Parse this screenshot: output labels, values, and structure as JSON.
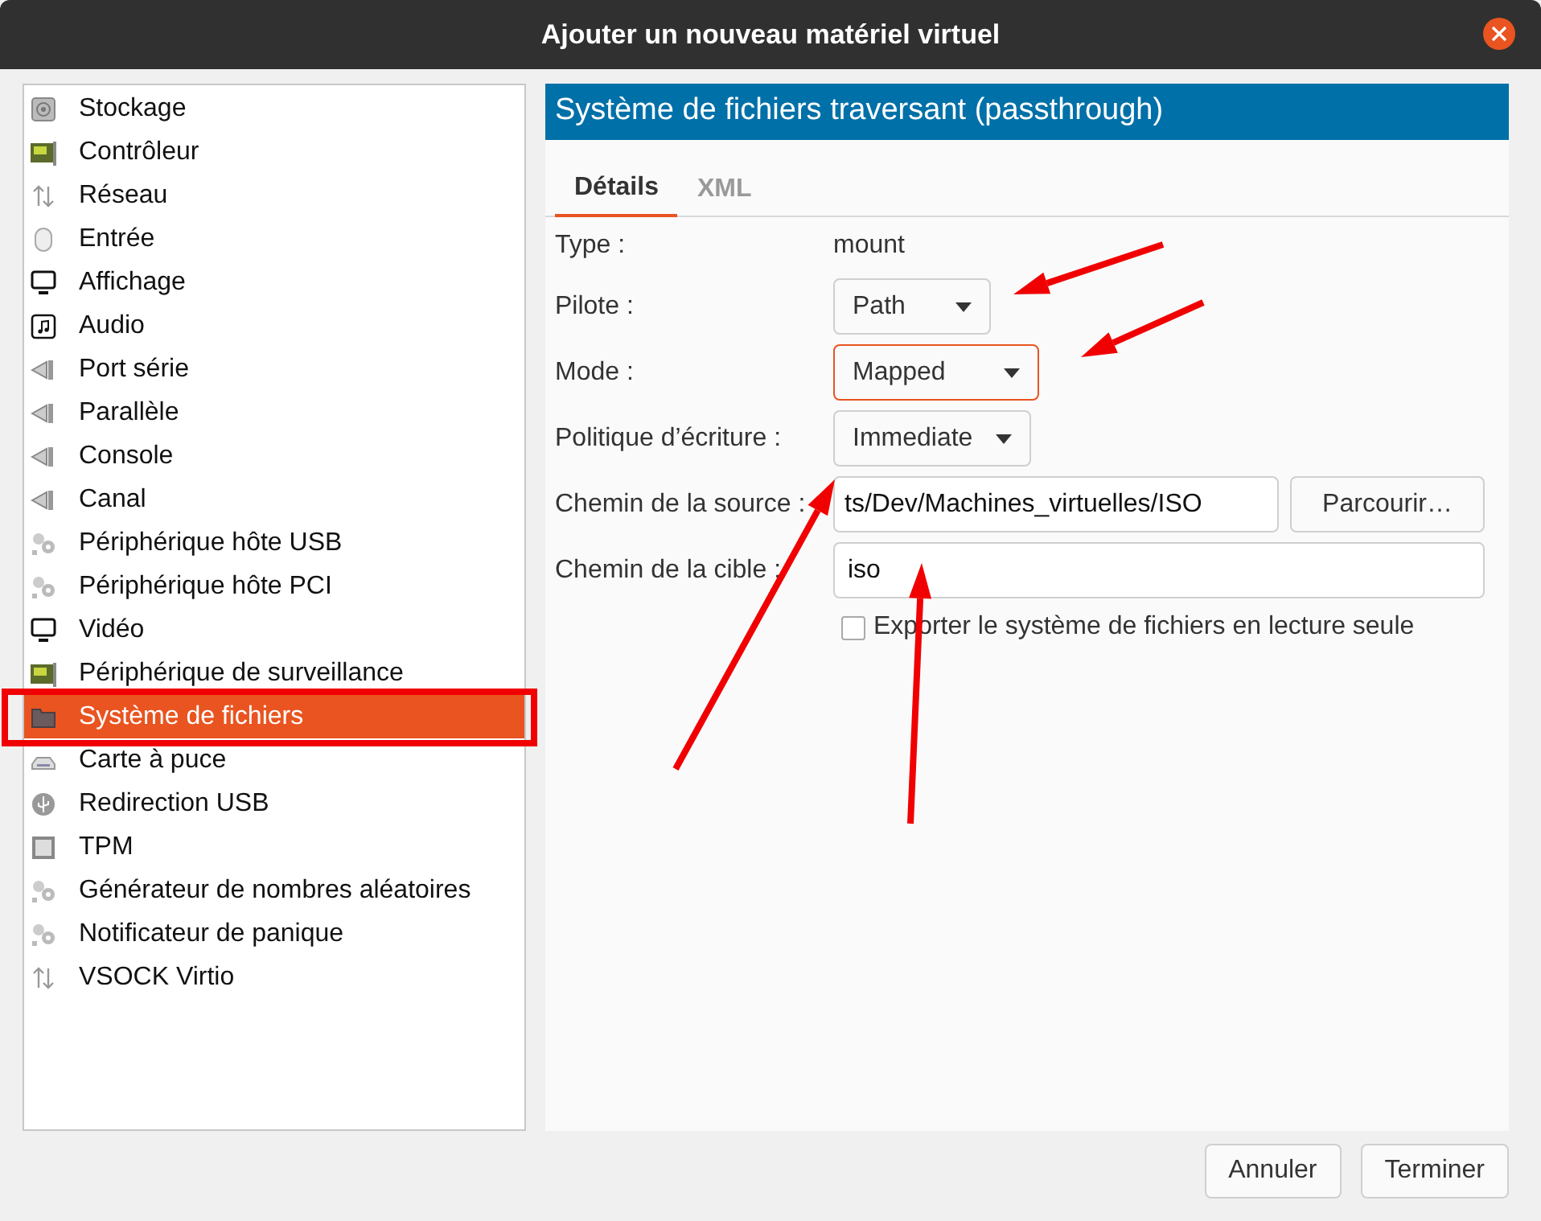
{
  "window": {
    "title": "Ajouter un nouveau matériel virtuel"
  },
  "sidebar": {
    "items": [
      {
        "label": "Stockage",
        "kind": "disk",
        "selected": false
      },
      {
        "label": "Contrôleur",
        "kind": "card",
        "selected": false
      },
      {
        "label": "Réseau",
        "kind": "network",
        "selected": false
      },
      {
        "label": "Entrée",
        "kind": "mouse",
        "selected": false
      },
      {
        "label": "Affichage",
        "kind": "monitor",
        "selected": false
      },
      {
        "label": "Audio",
        "kind": "audio",
        "selected": false
      },
      {
        "label": "Port série",
        "kind": "plug",
        "selected": false
      },
      {
        "label": "Parallèle",
        "kind": "plug",
        "selected": false
      },
      {
        "label": "Console",
        "kind": "plug",
        "selected": false
      },
      {
        "label": "Canal",
        "kind": "plug",
        "selected": false
      },
      {
        "label": "Périphérique hôte USB",
        "kind": "gears",
        "selected": false
      },
      {
        "label": "Périphérique hôte PCI",
        "kind": "gears",
        "selected": false
      },
      {
        "label": "Vidéo",
        "kind": "monitor",
        "selected": false
      },
      {
        "label": "Périphérique de surveillance",
        "kind": "card",
        "selected": false
      },
      {
        "label": "Système de fichiers",
        "kind": "folder",
        "selected": true
      },
      {
        "label": "Carte à puce",
        "kind": "smartcard",
        "selected": false
      },
      {
        "label": "Redirection USB",
        "kind": "usb",
        "selected": false
      },
      {
        "label": "TPM",
        "kind": "chip",
        "selected": false
      },
      {
        "label": "Générateur de nombres aléatoires",
        "kind": "gears",
        "selected": false
      },
      {
        "label": "Notificateur de panique",
        "kind": "gears",
        "selected": false
      },
      {
        "label": "VSOCK Virtio",
        "kind": "network",
        "selected": false
      }
    ]
  },
  "panel": {
    "header": "Système de fichiers traversant (passthrough)",
    "tabs": [
      {
        "label": "Détails",
        "selected": true
      },
      {
        "label": "XML",
        "selected": false
      }
    ],
    "form": [
      {
        "kind": "text",
        "label": "Type :",
        "value": "mount"
      },
      {
        "kind": "dropdown",
        "label": "Pilote :",
        "value": "Path",
        "focused": false
      },
      {
        "kind": "dropdown",
        "label": "Mode :",
        "value": "Mapped",
        "focused": true
      },
      {
        "kind": "dropdown",
        "label": "Politique d’écriture :",
        "value": "Immediate",
        "focused": false
      },
      {
        "kind": "path",
        "label": "Chemin de la source :",
        "value": "ts/Dev/Machines_virtuelles/ISO",
        "button": "Parcourir…"
      },
      {
        "kind": "field",
        "label": "Chemin de la cible :",
        "value": "iso"
      }
    ],
    "checkbox": {
      "label": "Exporter le système de fichiers en lecture seule",
      "checked": false
    }
  },
  "buttons": [
    "Annuler",
    "Terminer"
  ]
}
